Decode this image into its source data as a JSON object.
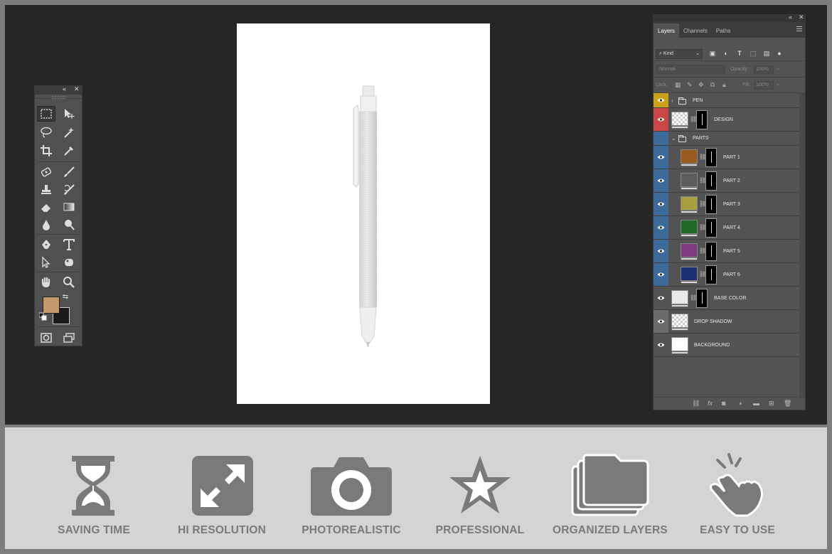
{
  "toolbox": {
    "header_icons": [
      "collapse-icon",
      "close-icon"
    ],
    "tools": [
      "rectangular-marquee-icon",
      "move-icon",
      "lasso-icon",
      "magic-wand-icon",
      "crop-icon",
      "eyedropper-icon",
      "healing-brush-icon",
      "brush-icon",
      "clone-stamp-icon",
      "history-brush-icon",
      "eraser-icon",
      "gradient-icon",
      "blur-icon",
      "dodge-icon",
      "pen-icon",
      "type-icon",
      "path-selection-icon",
      "custom-shape-icon",
      "hand-icon",
      "zoom-icon",
      "quick-mask-icon",
      "screen-mode-icon"
    ],
    "foreground_color": "#c49a6c",
    "background_color": "#1a1a1a"
  },
  "layers_panel": {
    "tabs": [
      "Layers",
      "Channels",
      "Paths"
    ],
    "active_tab": "Layers",
    "filter_kind": "Kind",
    "blend_mode": "Normal",
    "opacity_label": "Opacity:",
    "opacity_value": "100%",
    "lock_label": "Lock:",
    "fill_label": "Fill:",
    "fill_value": "100%",
    "layers": [
      {
        "name": "PEN",
        "type": "group",
        "eye_color": "#c9a21a"
      },
      {
        "name": "DESIGN",
        "type": "smart",
        "eye_color": "#c94747"
      },
      {
        "name": "PARTS",
        "type": "group-open",
        "eye_color": "#3e6a9a",
        "hidden": true
      },
      {
        "name": "PART 1",
        "type": "fill",
        "swatch": "#9a5a1f",
        "eye_color": "#3e6a9a"
      },
      {
        "name": "PART 2",
        "type": "fill",
        "swatch": "#5c5c5c",
        "eye_color": "#3e6a9a"
      },
      {
        "name": "PART 3",
        "type": "fill",
        "swatch": "#a8a040",
        "eye_color": "#3e6a9a"
      },
      {
        "name": "PART 4",
        "type": "fill",
        "swatch": "#1f6a24",
        "eye_color": "#3e6a9a"
      },
      {
        "name": "PART 5",
        "type": "fill",
        "swatch": "#7f3a80",
        "eye_color": "#3e6a9a"
      },
      {
        "name": "PART 6",
        "type": "fill",
        "swatch": "#1c2f70",
        "eye_color": "#3e6a9a"
      },
      {
        "name": "BASE COLOR",
        "type": "fill",
        "swatch": "#e8e8e8",
        "eye_color": "#535353"
      },
      {
        "name": "DROP SHADOW",
        "type": "transparent",
        "eye_color": "#6a6a6a"
      },
      {
        "name": "BACKGROUND",
        "type": "white",
        "eye_color": "#535353"
      }
    ],
    "bottom_icons": [
      "link-icon",
      "fx-icon",
      "mask-icon",
      "adjustment-icon",
      "folder-icon",
      "new-layer-icon",
      "trash-icon"
    ]
  },
  "features": [
    {
      "label": "SAVING TIME",
      "icon": "hourglass-icon"
    },
    {
      "label": "HI RESOLUTION",
      "icon": "expand-icon"
    },
    {
      "label": "PHOTOREALISTIC",
      "icon": "camera-icon"
    },
    {
      "label": "PROFESSIONAL",
      "icon": "star-icon"
    },
    {
      "label": "ORGANIZED LAYERS",
      "icon": "layers-folder-icon"
    },
    {
      "label": "EASY TO USE",
      "icon": "hand-tap-icon"
    }
  ]
}
